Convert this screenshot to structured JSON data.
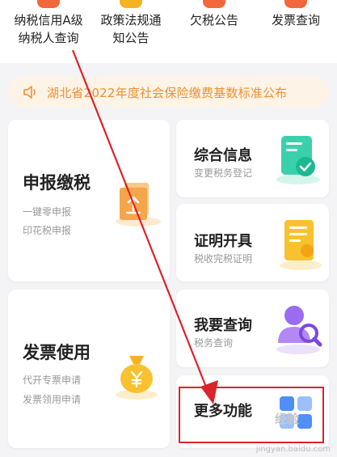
{
  "top_menu": [
    {
      "line1": "纳税信用A级",
      "line2": "纳税人查询",
      "icon": "credit-icon",
      "color": "#f2673b"
    },
    {
      "line1": "政策法规通",
      "line2": "知公告",
      "icon": "policy-icon",
      "color": "#f5b324"
    },
    {
      "line1": "欠税公告",
      "line2": "",
      "icon": "arrears-icon",
      "color": "#f2673b"
    },
    {
      "line1": "发票查询",
      "line2": "",
      "icon": "invoice-query-icon",
      "color": "#f2673b"
    }
  ],
  "notice": {
    "text": "湖北省2022年度社会保险缴费基数标准公布",
    "icon": "speaker-icon"
  },
  "cards": {
    "declare": {
      "title": "申报缴税",
      "sub1": "一键零申报",
      "sub2": "印花税申报",
      "icon": "upload-file-icon"
    },
    "info": {
      "title": "综合信息",
      "sub": "变更税务登记",
      "icon": "info-doc-icon"
    },
    "cert": {
      "title": "证明开具",
      "sub": "税收完税证明",
      "icon": "certificate-icon"
    },
    "invoice_use": {
      "title": "发票使用",
      "sub1": "代开专票申请",
      "sub2": "发票领用申请",
      "icon": "money-bag-icon"
    },
    "query": {
      "title": "我要查询",
      "sub": "税务查询",
      "icon": "user-search-icon"
    },
    "more": {
      "title": "更多功能",
      "icon": "grid-icon"
    }
  },
  "watermark": {
    "brand": "经验",
    "url": "jingyan.baidu.com"
  },
  "colors": {
    "accent": "#f08f2e",
    "highlight": "#d9242a"
  }
}
